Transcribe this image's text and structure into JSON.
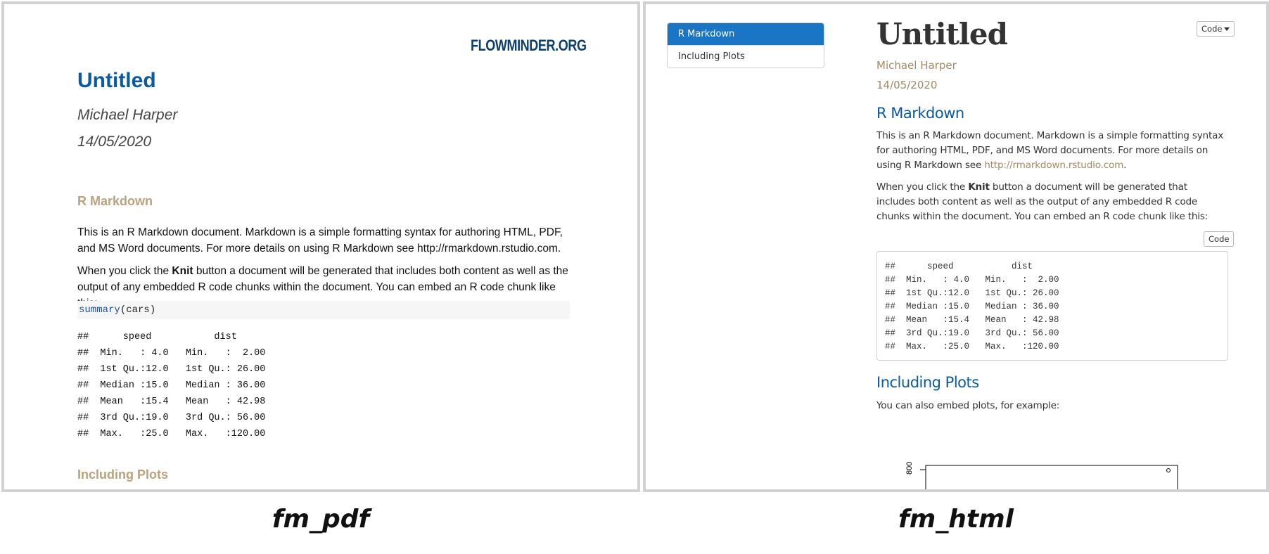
{
  "pdf": {
    "logo": "FLOWMINDER.ORG",
    "title": "Untitled",
    "author": "Michael Harper",
    "date": "14/05/2020",
    "section1": "R Markdown",
    "para1": "This is an R Markdown document. Markdown is a simple formatting syntax for authoring HTML, PDF, and MS Word documents. For more details on using R Markdown see http://rmarkdown.rstudio.com.",
    "para2_before": "When you click the ",
    "para2_bold": "Knit",
    "para2_after": " button a document will be generated that includes both content as well as the output of any embedded R code chunks within the document. You can embed an R code chunk like this:",
    "code_fn": "summary",
    "code_args": "(cars)",
    "output": "##      speed           dist       \n##  Min.   : 4.0   Min.   :  2.00  \n##  1st Qu.:12.0   1st Qu.: 26.00  \n##  Median :15.0   Median : 36.00  \n##  Mean   :15.4   Mean   : 42.98  \n##  3rd Qu.:19.0   3rd Qu.: 56.00  \n##  Max.   :25.0   Max.   :120.00",
    "section2": "Including Plots"
  },
  "html": {
    "toc": [
      "R Markdown",
      "Including Plots"
    ],
    "code_button_top": "Code",
    "title": "Untitled",
    "author": "Michael Harper",
    "date": "14/05/2020",
    "section1": "R Markdown",
    "para1_before": "This is an R Markdown document. Markdown is a simple formatting syntax for authoring HTML, PDF, and MS Word documents. For more details on using R Markdown see ",
    "para1_link": "http://rmarkdown.rstudio.com",
    "para1_after": ".",
    "para2_before": "When you click the ",
    "para2_bold": "Knit",
    "para2_after": " button a document will be generated that includes both content as well as the output of any embedded R code chunks within the document. You can embed an R code chunk like this:",
    "code_button_chunk": "Code",
    "output": "##      speed           dist       \n##  Min.   : 4.0   Min.   :  2.00  \n##  1st Qu.:12.0   1st Qu.: 26.00  \n##  Median :15.0   Median : 36.00  \n##  Mean   :15.4   Mean   : 42.98  \n##  3rd Qu.:19.0   3rd Qu.: 56.00  \n##  Max.   :25.0   Max.   :120.00",
    "section2": "Including Plots",
    "para3": "You can also embed plots, for example:",
    "plot_tick_label": "800"
  },
  "captions": {
    "left": "fm_pdf",
    "right": "fm_html"
  }
}
